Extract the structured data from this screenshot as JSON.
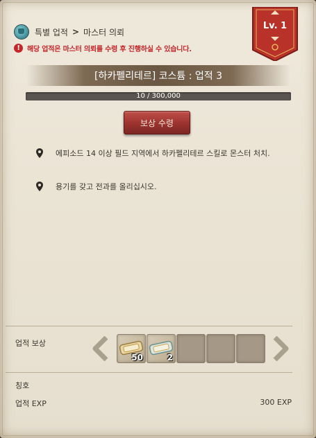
{
  "breadcrumb": {
    "category": "특별 업적",
    "separator": ">",
    "current": "마스터 의뢰"
  },
  "warning": {
    "icon": "exclamation-icon",
    "text": "해당 업적은 마스터 의뢰를 수령 후 진행하실 수 있습니다."
  },
  "level_badge": {
    "text": "Lv. 1"
  },
  "achievement": {
    "title": "[하카펠리테르] 코스튬 : 업적 3",
    "progress_text": "10 / 300,000",
    "progress_current": 10,
    "progress_total": 300000
  },
  "reward_button": {
    "label": "보상 수령"
  },
  "objectives": [
    {
      "text": "에피소드 14 이상 필드 지역에서 하카펠리테르 스킬로 몬스터 처치."
    },
    {
      "text": "용기를 갖고 전과를 올리십시오."
    }
  ],
  "rewards": {
    "label": "업적 보상",
    "items": [
      {
        "count": "50",
        "icon": "ticket-scroll-icon"
      },
      {
        "count": "2",
        "icon": "ticket-scroll-icon"
      },
      {
        "count": "",
        "icon": "empty-slot"
      },
      {
        "count": "",
        "icon": "empty-slot"
      },
      {
        "count": "",
        "icon": "empty-slot"
      }
    ]
  },
  "title_row": {
    "label": "칭호"
  },
  "exp_row": {
    "label": "업적 EXP",
    "value": "300 EXP"
  },
  "colors": {
    "accent_red": "#c4262a",
    "button_red": "#9e3430",
    "badge_red": "#b8322a"
  }
}
